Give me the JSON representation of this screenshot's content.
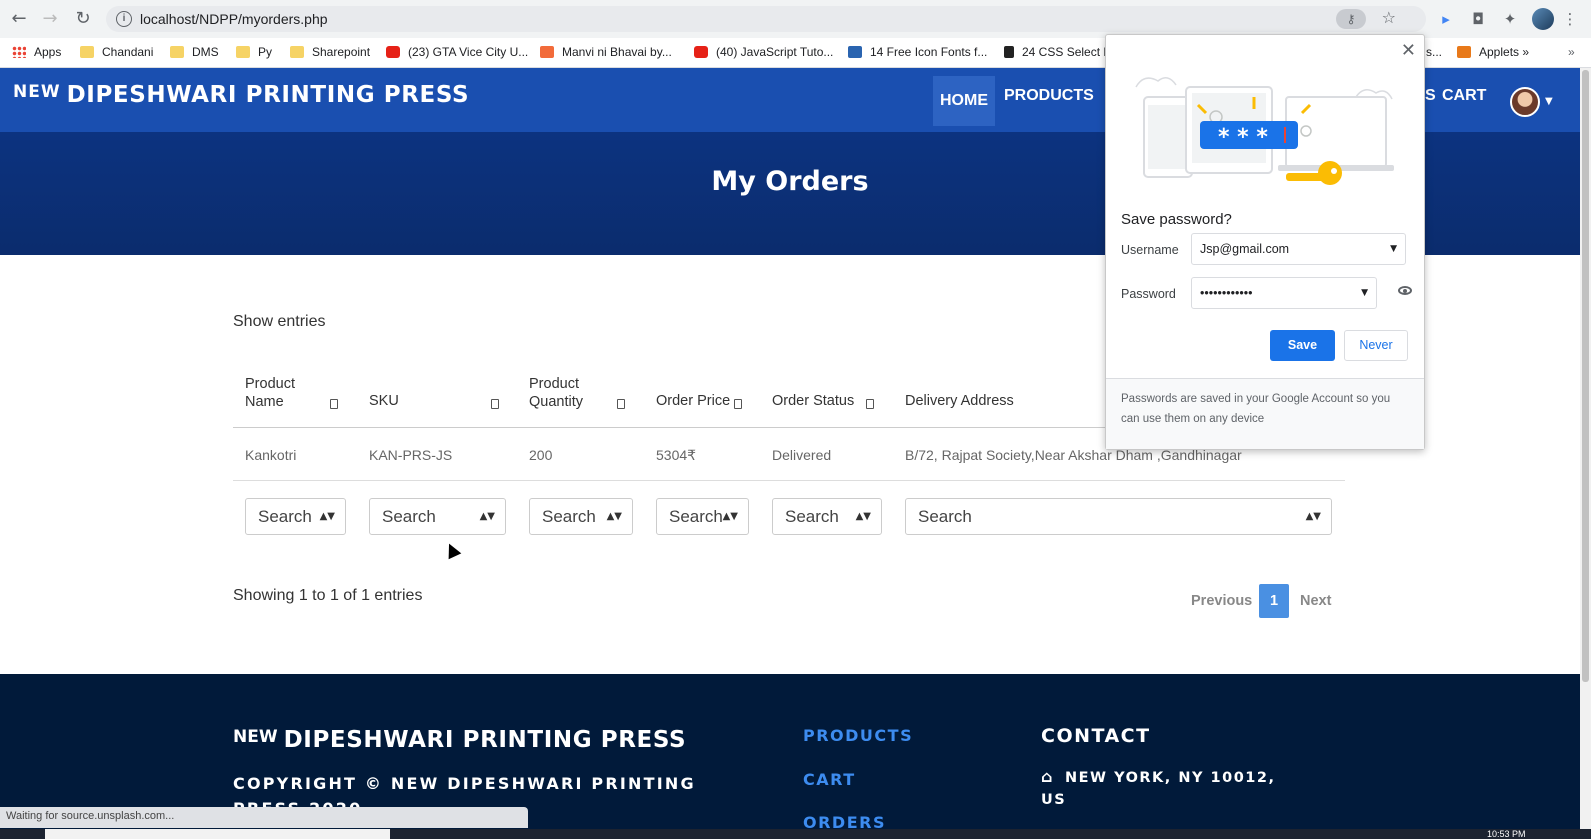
{
  "browser": {
    "url": "localhost/NDPP/myorders.php",
    "bookmarks": [
      "Apps",
      "Chandani",
      "DMS",
      "Py",
      "Sharepoint",
      "(23) GTA Vice City U...",
      "Manvi ni Bhavai by...",
      "(40) JavaScript Tuto...",
      "14 Free Icon Fonts f...",
      "24 CSS Select E",
      "s...",
      "Applets",
      "»"
    ],
    "status_text": "Waiting for source.unsplash.com...",
    "clock": "10:53 PM"
  },
  "nav": {
    "brand_sup": "NEW",
    "brand_main": "DIPESHWARI PRINTING PRESS",
    "links": [
      "HOME",
      "PRODUCTS",
      "S",
      "CART"
    ]
  },
  "hero": {
    "title": "My Orders"
  },
  "table": {
    "show_entries": "Show entries",
    "headers": [
      "Product Name",
      "SKU",
      "Product Quantity",
      "Order Price",
      "Order Status",
      "Delivery Address"
    ],
    "rows": [
      [
        "Kankotri",
        "KAN-PRS-JS",
        "200",
        "5304₹",
        "Delivered",
        "B/72, Rajpat Society,Near Akshar Dham ,Gandhinagar"
      ]
    ],
    "filter_placeholder": "Search",
    "showing": "Showing 1 to 1 of 1 entries",
    "pagination": {
      "previous": "Previous",
      "current": "1",
      "next": "Next"
    }
  },
  "footer": {
    "brand_sup": "NEW",
    "brand_main": "DIPESHWARI PRINTING PRESS",
    "copyright": "COPYRIGHT © NEW DIPESHWARI PRINTING PRESS 2020",
    "links": [
      "PRODUCTS",
      "CART",
      "ORDERS"
    ],
    "contact_title": "CONTACT",
    "address": "NEW YORK, NY 10012, US"
  },
  "password_popup": {
    "title": "Save password?",
    "username_label": "Username",
    "username_value": "Jsp@gmail.com",
    "password_label": "Password",
    "password_value": "••••••••••••",
    "save": "Save",
    "never": "Never",
    "footnote": "Passwords are saved in your Google Account so you can use them on any device"
  }
}
